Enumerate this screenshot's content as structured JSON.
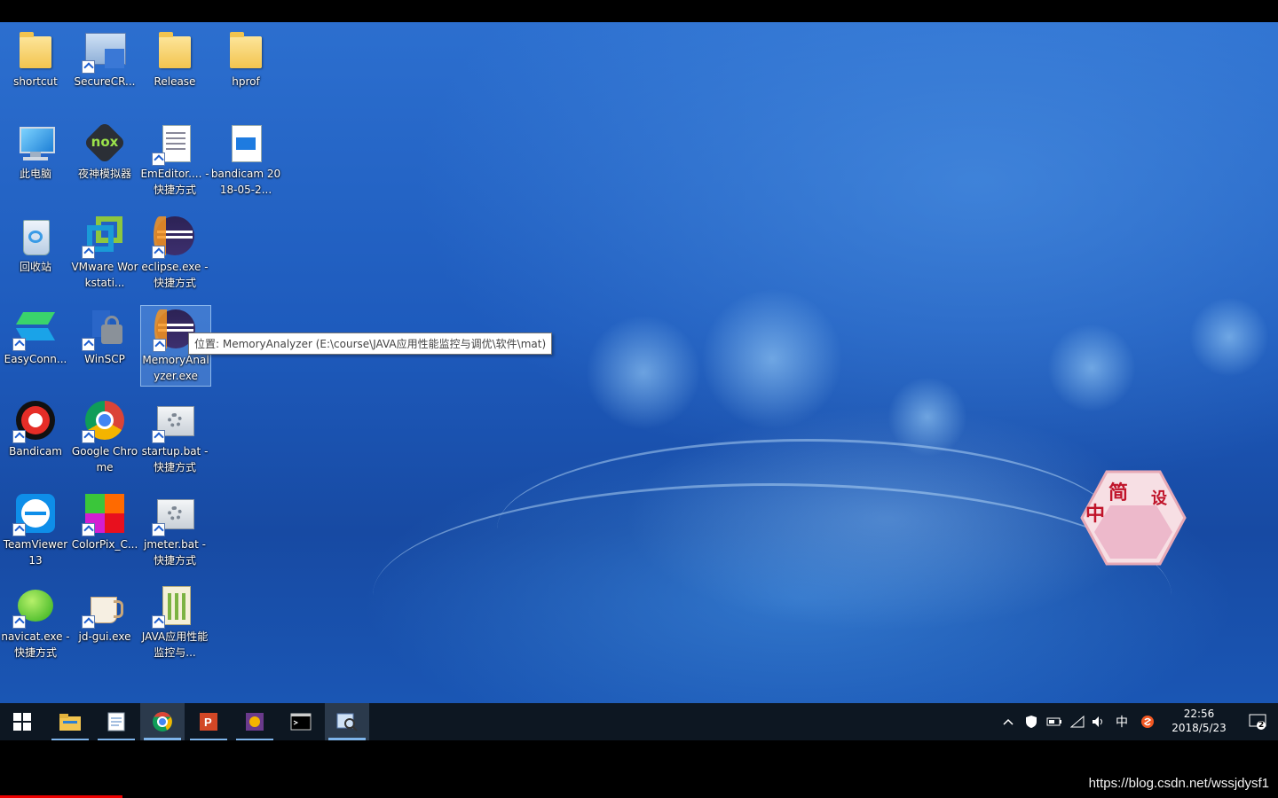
{
  "desktop": {
    "icons": [
      {
        "label": "shortcut",
        "icon": "folder-icon"
      },
      {
        "label": "SecureCR...",
        "icon": "securecrt-icon"
      },
      {
        "label": "Release",
        "icon": "folder-icon"
      },
      {
        "label": "hprof",
        "icon": "folder-icon"
      },
      {
        "label": "此电脑",
        "icon": "computer-icon"
      },
      {
        "label": "夜神模拟器",
        "icon": "nox-icon"
      },
      {
        "label": "EmEditor.... - 快捷方式",
        "icon": "emeditor-icon"
      },
      {
        "label": "bandicam 2018-05-2...",
        "icon": "video-file-icon"
      },
      {
        "label": "回收站",
        "icon": "recycle-bin-icon"
      },
      {
        "label": "VMware Workstati...",
        "icon": "vmware-icon"
      },
      {
        "label": "eclipse.exe - 快捷方式",
        "icon": "eclipse-icon"
      },
      {
        "label": "EasyConn...",
        "icon": "easyconnect-icon"
      },
      {
        "label": "WinSCP",
        "icon": "winscp-icon"
      },
      {
        "label": "MemoryAnalyzer.exe",
        "icon": "memory-analyzer-icon"
      },
      {
        "label": "Bandicam",
        "icon": "bandicam-icon"
      },
      {
        "label": "Google Chrome",
        "icon": "chrome-icon"
      },
      {
        "label": "startup.bat - 快捷方式",
        "icon": "batch-file-icon"
      },
      {
        "label": "TeamViewer 13",
        "icon": "teamviewer-icon"
      },
      {
        "label": "ColorPix_C...",
        "icon": "colorpix-icon"
      },
      {
        "label": "jmeter.bat - 快捷方式",
        "icon": "batch-file-icon"
      },
      {
        "label": "navicat.exe - 快捷方式",
        "icon": "navicat-icon"
      },
      {
        "label": "jd-gui.exe",
        "icon": "jd-gui-icon"
      },
      {
        "label": "JAVA应用性能监控与...",
        "icon": "document-icon"
      }
    ],
    "tooltip": "位置: MemoryAnalyzer (E:\\course\\JAVA应用性能监控与调优\\软件\\mat)"
  },
  "taskbar": {
    "apps": [
      {
        "icon": "windows-start-icon",
        "state": "none"
      },
      {
        "icon": "file-explorer-icon",
        "state": "running"
      },
      {
        "icon": "notepad-icon",
        "state": "running"
      },
      {
        "icon": "chrome-icon",
        "state": "active"
      },
      {
        "icon": "powerpoint-icon",
        "state": "running"
      },
      {
        "icon": "app-icon",
        "state": "running"
      },
      {
        "icon": "terminal-icon",
        "state": "none"
      },
      {
        "icon": "memory-analyzer-icon",
        "state": "active"
      }
    ],
    "tray": {
      "ime": "中",
      "time": "22:56",
      "date": "2018/5/23",
      "notifications": "2"
    }
  },
  "overlay": {
    "watermark": "https://blog.csdn.net/wssjdysf1",
    "logo_text": [
      "简",
      "中",
      "设"
    ]
  },
  "colors": {
    "desktop": "#1e5bbd",
    "taskbar": "#0d1722",
    "accent": "#7eb4ea",
    "progress": "#e00000"
  }
}
